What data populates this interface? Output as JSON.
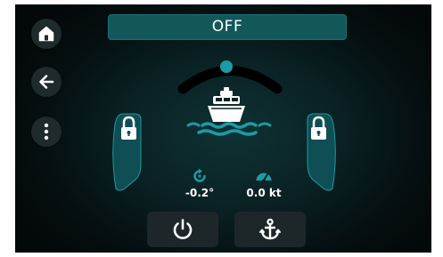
{
  "status": {
    "mode_label": "OFF"
  },
  "sidebar": {
    "home_icon": "home-icon",
    "back_icon": "arrow-left-icon",
    "menu_icon": "more-vertical-icon"
  },
  "readouts": {
    "heading_offset": "-0.2°",
    "speed": "0.0 kt"
  },
  "thrusters": {
    "left_locked": true,
    "right_locked": true
  },
  "bottom_bar": {
    "power_icon": "power-icon",
    "anchor_icon": "anchor-icon"
  },
  "colors": {
    "accent": "#1b9ba5",
    "status_bar": "#12585a",
    "button_bg": "#1f2a2c"
  }
}
